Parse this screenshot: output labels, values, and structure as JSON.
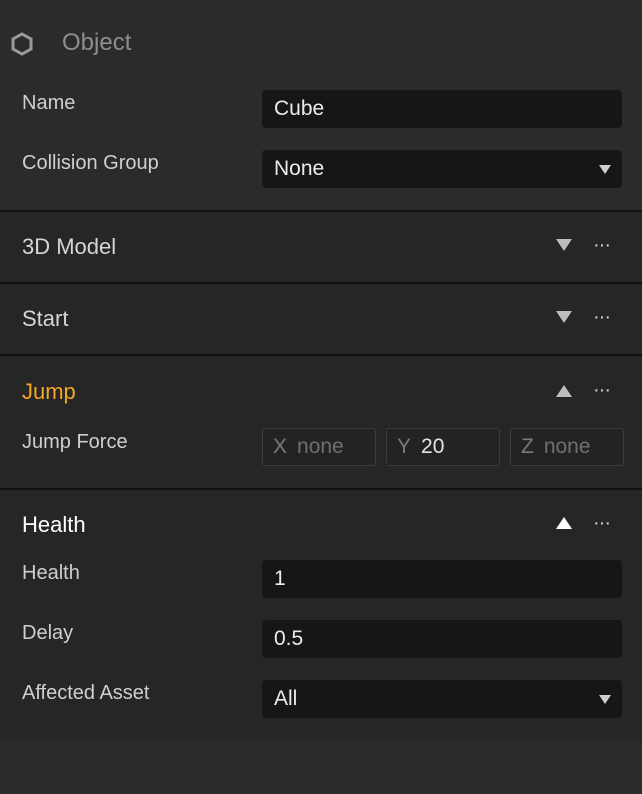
{
  "object": {
    "header": "Object",
    "name_label": "Name",
    "name_value": "Cube",
    "collision_label": "Collision Group",
    "collision_value": "None"
  },
  "sections": {
    "model": {
      "title": "3D Model"
    },
    "start": {
      "title": "Start"
    },
    "jump": {
      "title": "Jump",
      "force_label": "Jump Force",
      "x_label": "X",
      "x_value": "none",
      "y_label": "Y",
      "y_value": "20",
      "z_label": "Z",
      "z_value": "none"
    },
    "health": {
      "title": "Health",
      "health_label": "Health",
      "health_value": "1",
      "delay_label": "Delay",
      "delay_value": "0.5",
      "asset_label": "Affected Asset",
      "asset_value": "All"
    }
  },
  "menu_glyph": "···",
  "colors": {
    "panel_bg": "#2b2b2b",
    "section_bg": "#262626",
    "input_bg": "#161616",
    "accent_orange": "#f5a623",
    "divider": "#111111"
  },
  "icons": {
    "object": "hexagon-icon",
    "collapse": "triangle-down-icon",
    "expand": "triangle-up-icon",
    "menu": "more-dots-icon"
  }
}
